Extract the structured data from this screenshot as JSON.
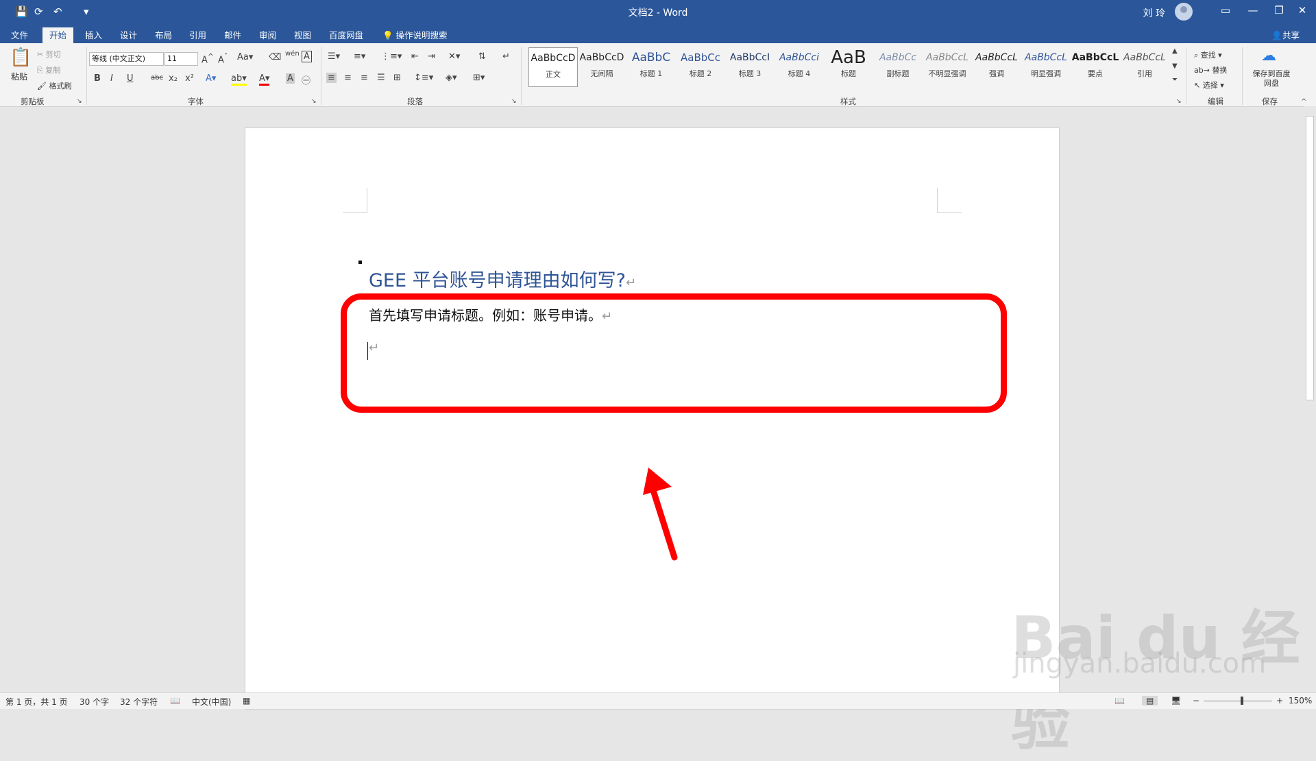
{
  "titlebar": {
    "doc_title": "文档2  -  Word",
    "user": "刘 玲"
  },
  "tabs": [
    "文件",
    "开始",
    "插入",
    "设计",
    "布局",
    "引用",
    "邮件",
    "审阅",
    "视图",
    "百度网盘"
  ],
  "tell_me": "操作说明搜索",
  "share": "共享",
  "clipboard": {
    "paste": "粘贴",
    "cut": "剪切",
    "copy": "复制",
    "format_painter": "格式刷",
    "label": "剪贴板"
  },
  "font": {
    "name": "等线 (中文正文)",
    "size": "11",
    "label": "字体"
  },
  "paragraph": {
    "label": "段落"
  },
  "styles": {
    "label": "样式",
    "items": [
      {
        "preview": "AaBbCcD",
        "name": "正文"
      },
      {
        "preview": "AaBbCcD",
        "name": "无间隔"
      },
      {
        "preview": "AaBbC",
        "name": "标题 1"
      },
      {
        "preview": "AaBbCc",
        "name": "标题 2"
      },
      {
        "preview": "AaBbCcI",
        "name": "标题 3"
      },
      {
        "preview": "AaBbCci",
        "name": "标题 4"
      },
      {
        "preview": "AaB",
        "name": "标题"
      },
      {
        "preview": "AaBbCc",
        "name": "副标题"
      },
      {
        "preview": "AaBbCcL",
        "name": "不明显强调"
      },
      {
        "preview": "AaBbCcL",
        "name": "强调"
      },
      {
        "preview": "AaBbCcL",
        "name": "明显强调"
      },
      {
        "preview": "AaBbCcL",
        "name": "要点"
      },
      {
        "preview": "AaBbCcL",
        "name": "引用"
      }
    ]
  },
  "editing": {
    "find": "查找",
    "replace": "替换",
    "select": "选择",
    "label": "编辑"
  },
  "save": {
    "button": "保存到百度网盘",
    "label": "保存"
  },
  "document": {
    "heading": "GEE 平台账号申请理由如何写?",
    "body": "首先填写申请标题。例如：账号申请。",
    "para_mark": "↵"
  },
  "status": {
    "page": "第 1 页，共 1 页",
    "words": "30 个字",
    "chars": "32 个字符",
    "lang": "中文(中国)",
    "zoom": "150%"
  },
  "watermark": {
    "line1": "Bai du 经验",
    "line2": "jingyan.baidu.com"
  },
  "colors": {
    "accent": "#2b579a",
    "annotation": "#ff0000",
    "heading": "#2f5496"
  }
}
